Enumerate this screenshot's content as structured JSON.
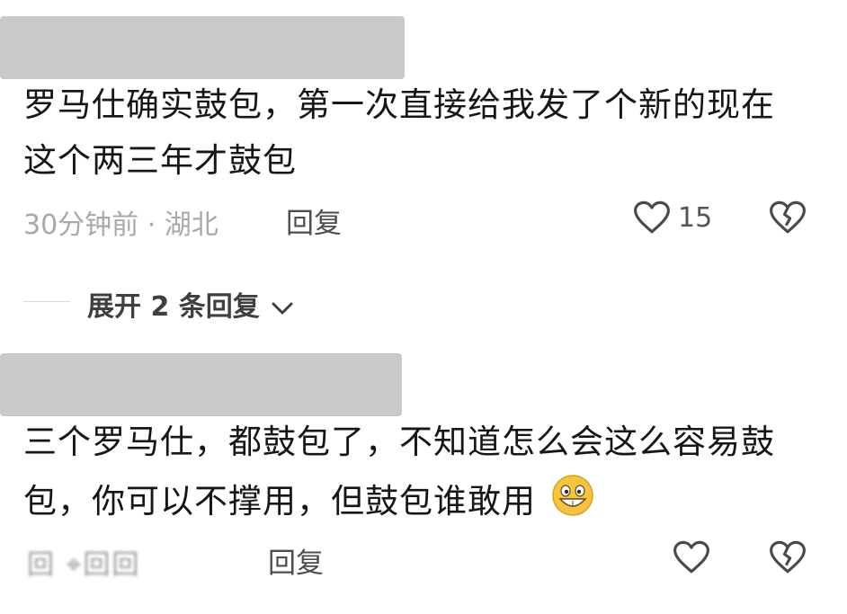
{
  "comments": [
    {
      "line1": "罗马仕确实鼓包，第一次直接给我发了个新的现在",
      "line2": "这个两三年才鼓包",
      "meta": "30分钟前 · 湖北",
      "reply_label": "回复",
      "likes": "15"
    },
    {
      "line1": "三个罗马仕，都鼓包了，不知道怎么会这么容易鼓",
      "line2": "包，你可以不撑用，但鼓包谁敢用",
      "meta": "回 ⌖回回",
      "reply_label": "回复"
    }
  ],
  "expand": {
    "label": "展开 2 条回复"
  },
  "icons": {
    "like": "heart-outline-icon",
    "dislike": "broken-heart-icon",
    "chevron": "chevron-down-icon",
    "emoji": "grinning-emoji-icon"
  },
  "colors": {
    "redaction": "#c9c9c9",
    "meta": "#a8a8a8",
    "emoji": "#f5c542"
  }
}
